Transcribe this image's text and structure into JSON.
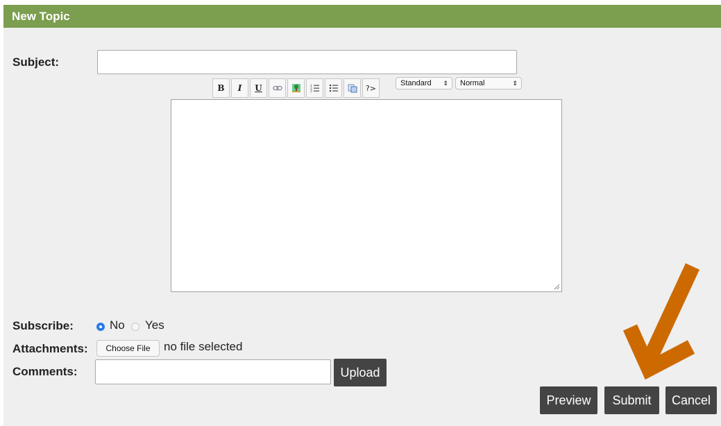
{
  "header": {
    "title": "New Topic"
  },
  "form": {
    "subject_label": "Subject:",
    "subject_value": "",
    "subscribe_label": "Subscribe:",
    "subscribe_options": [
      {
        "label": "No",
        "selected": true
      },
      {
        "label": "Yes",
        "selected": false
      }
    ],
    "attachments_label": "Attachments:",
    "choose_file_label": "Choose File",
    "file_status": "no file selected",
    "comments_label": "Comments:",
    "comments_value": "",
    "upload_label": "Upload"
  },
  "toolbar": {
    "buttons": [
      {
        "icon": "bold-icon",
        "glyph": "B"
      },
      {
        "icon": "italic-icon",
        "glyph": "I"
      },
      {
        "icon": "underline-icon",
        "glyph": "U"
      },
      {
        "icon": "link-icon"
      },
      {
        "icon": "image-icon"
      },
      {
        "icon": "ordered-list-icon"
      },
      {
        "icon": "unordered-list-icon"
      },
      {
        "icon": "copy-icon"
      },
      {
        "icon": "code-icon",
        "glyph": "?>"
      }
    ],
    "font_select": "Standard",
    "size_select": "Normal"
  },
  "actions": {
    "preview_label": "Preview",
    "submit_label": "Submit",
    "cancel_label": "Cancel"
  },
  "colors": {
    "header_bg": "#7b9e4f",
    "panel_bg": "#efefef",
    "button_bg": "#444444",
    "annotation_arrow": "#cc6a00",
    "radio_selected": "#2a7be4"
  }
}
